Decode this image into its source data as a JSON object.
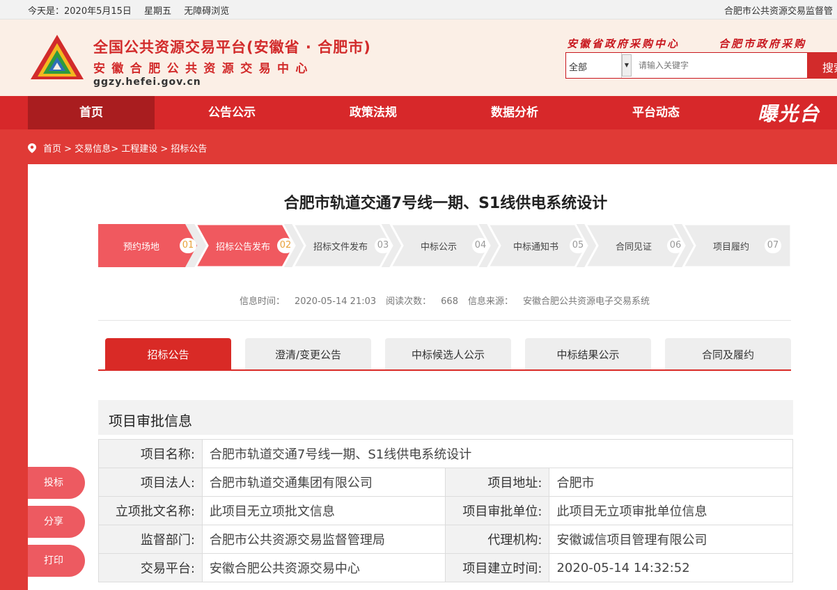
{
  "topbar": {
    "date": "今天是：2020年5月15日",
    "weekday": "星期五",
    "accessibility": "无障碍浏览",
    "right_link": "合肥市公共资源交易监督管"
  },
  "header": {
    "title": "全国公共资源交易平台(安徽省 · 合肥市)",
    "subtitle": "安徽合肥公共资源交易中心",
    "domain": "ggzy.hefei.gov.cn",
    "links": [
      "安徽省政府采购中心",
      "合肥市政府采购"
    ],
    "search": {
      "select_value": "全部",
      "placeholder": "请输入关键字",
      "button": "搜索"
    }
  },
  "nav": {
    "items": [
      "首页",
      "公告公示",
      "政策法规",
      "数据分析",
      "平台动态"
    ],
    "active": 0,
    "slogan": "曝光台"
  },
  "breadcrumb": [
    "首页",
    "交易信息",
    "工程建设",
    "招标公告"
  ],
  "project_title": "合肥市轨道交通7号线一期、S1线供电系统设计",
  "steps": [
    {
      "label": "预约场地",
      "num": "01",
      "done": true
    },
    {
      "label": "招标公告发布",
      "num": "02",
      "done": true
    },
    {
      "label": "招标文件发布",
      "num": "03",
      "done": false
    },
    {
      "label": "中标公示",
      "num": "04",
      "done": false
    },
    {
      "label": "中标通知书",
      "num": "05",
      "done": false
    },
    {
      "label": "合同见证",
      "num": "06",
      "done": false
    },
    {
      "label": "项目履约",
      "num": "07",
      "done": false
    }
  ],
  "info": {
    "time_label": "信息时间：",
    "time": "2020-05-14 21:03",
    "views_label": "阅读次数：",
    "views": "668",
    "source_label": "信息来源：",
    "source": "安徽合肥公共资源电子交易系统"
  },
  "tabs": [
    "招标公告",
    "澄清/变更公告",
    "中标候选人公示",
    "中标结果公示",
    "合同及履约"
  ],
  "section_title": "项目审批信息",
  "table": {
    "name_label": "项目名称:",
    "name": "合肥市轨道交通7号线一期、S1线供电系统设计",
    "legal_label": "项目法人:",
    "legal": "合肥市轨道交通集团有限公司",
    "addr_label": "项目地址:",
    "addr": "合肥市",
    "approval_doc_label": "立项批文名称:",
    "approval_doc": "此项目无立项批文信息",
    "approval_unit_label": "项目审批单位:",
    "approval_unit": "此项目无立项审批单位信息",
    "supervisor_label": "监督部门:",
    "supervisor": "合肥市公共资源交易监督管理局",
    "agent_label": "代理机构:",
    "agent": "安徽诚信项目管理有限公司",
    "platform_label": "交易平台:",
    "platform": "安徽合肥公共资源交易中心",
    "created_label": "项目建立时间:",
    "created": "2020-05-14 14:32:52"
  },
  "side_buttons": [
    "投标",
    "分享",
    "打印"
  ],
  "colors": {
    "primary_red": "#d7282a",
    "step_done": "#f0595f",
    "header_bg": "#fbefe6"
  }
}
